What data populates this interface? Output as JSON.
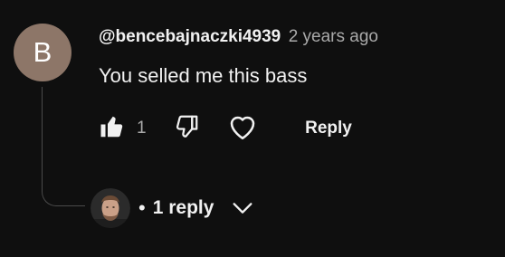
{
  "comment": {
    "avatar_letter": "B",
    "avatar_color": "#8d7668",
    "author": "@bencebajnaczki4939",
    "timestamp": "2 years ago",
    "text": "You selled me this bass",
    "like_count": "1",
    "reply_label": "Reply"
  },
  "replies": {
    "dot": "•",
    "label": "1 reply"
  },
  "icons": {
    "like": "thumbs-up-icon",
    "dislike": "thumbs-down-icon",
    "heart": "heart-icon",
    "chevron": "chevron-down-icon"
  }
}
